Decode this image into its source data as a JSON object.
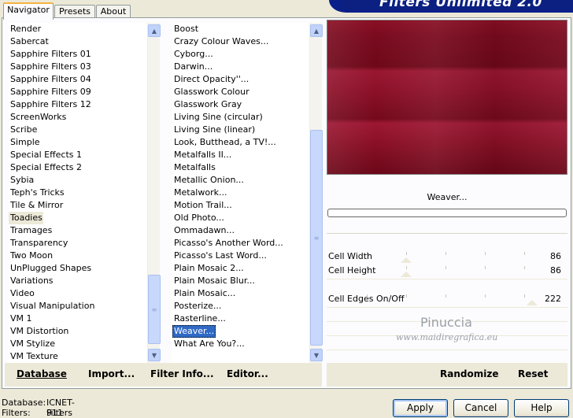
{
  "banner": {
    "title": "Filters Unlimited 2.0"
  },
  "tabs": [
    {
      "label": "Navigator",
      "active": true
    },
    {
      "label": "Presets",
      "active": false
    },
    {
      "label": "About",
      "active": false
    }
  ],
  "categories": {
    "items": [
      "Render",
      "Sabercat",
      "Sapphire Filters 01",
      "Sapphire Filters 03",
      "Sapphire Filters 04",
      "Sapphire Filters 09",
      "Sapphire Filters 12",
      "ScreenWorks",
      "Scribe",
      "Simple",
      "Special Effects 1",
      "Special Effects 2",
      "Sybia",
      "Teph's Tricks",
      "Tile & Mirror",
      "Toadies",
      "Tramages",
      "Transparency",
      "Two Moon",
      "UnPlugged Shapes",
      "Variations",
      "Video",
      "Visual Manipulation",
      "VM 1",
      "VM Distortion",
      "VM Stylize",
      "VM Texture"
    ],
    "selected": "Toadies"
  },
  "filters": {
    "items": [
      "Boost",
      "Crazy Colour Waves...",
      "Cyborg...",
      "Darwin...",
      "Direct Opacity''...",
      "Glasswork Colour",
      "Glasswork Gray",
      "Living Sine (circular)",
      "Living Sine (linear)",
      "Look, Butthead, a TV!...",
      "Metalfalls II...",
      "Metalfalls",
      "Metallic Onion...",
      "Metalwork...",
      "Motion Trail...",
      "Old Photo...",
      "Ommadawn...",
      "Picasso's Another Word...",
      "Picasso's Last Word...",
      "Plain Mosaic 2...",
      "Plain Mosaic Blur...",
      "Plain Mosaic...",
      "Posterize...",
      "Rasterline...",
      "Weaver...",
      "What Are You?..."
    ],
    "selected": "Weaver..."
  },
  "preview": {
    "filter_name": "Weaver..."
  },
  "params": [
    {
      "label": "Cell Width",
      "value": "86"
    },
    {
      "label": "Cell Height",
      "value": "86"
    },
    {
      "label": "Cell Edges On/Off",
      "value": "222"
    }
  ],
  "watermark": {
    "line1": "Pinuccia",
    "line2": "www.maidiregrafica.eu"
  },
  "toolbar": {
    "database": "Database",
    "import": "Import...",
    "filter_info": "Filter Info...",
    "editor": "Editor...",
    "randomize": "Randomize",
    "reset": "Reset"
  },
  "status": {
    "database_label": "Database:",
    "database_value": "ICNET-Filters",
    "filters_label": "Filters:",
    "filters_value": "911"
  },
  "buttons": {
    "apply": "Apply",
    "cancel": "Cancel",
    "help": "Help"
  },
  "colors": {
    "selection": "#316ac5",
    "banner": "#0b2080",
    "preview_base": "#8a0f24"
  }
}
